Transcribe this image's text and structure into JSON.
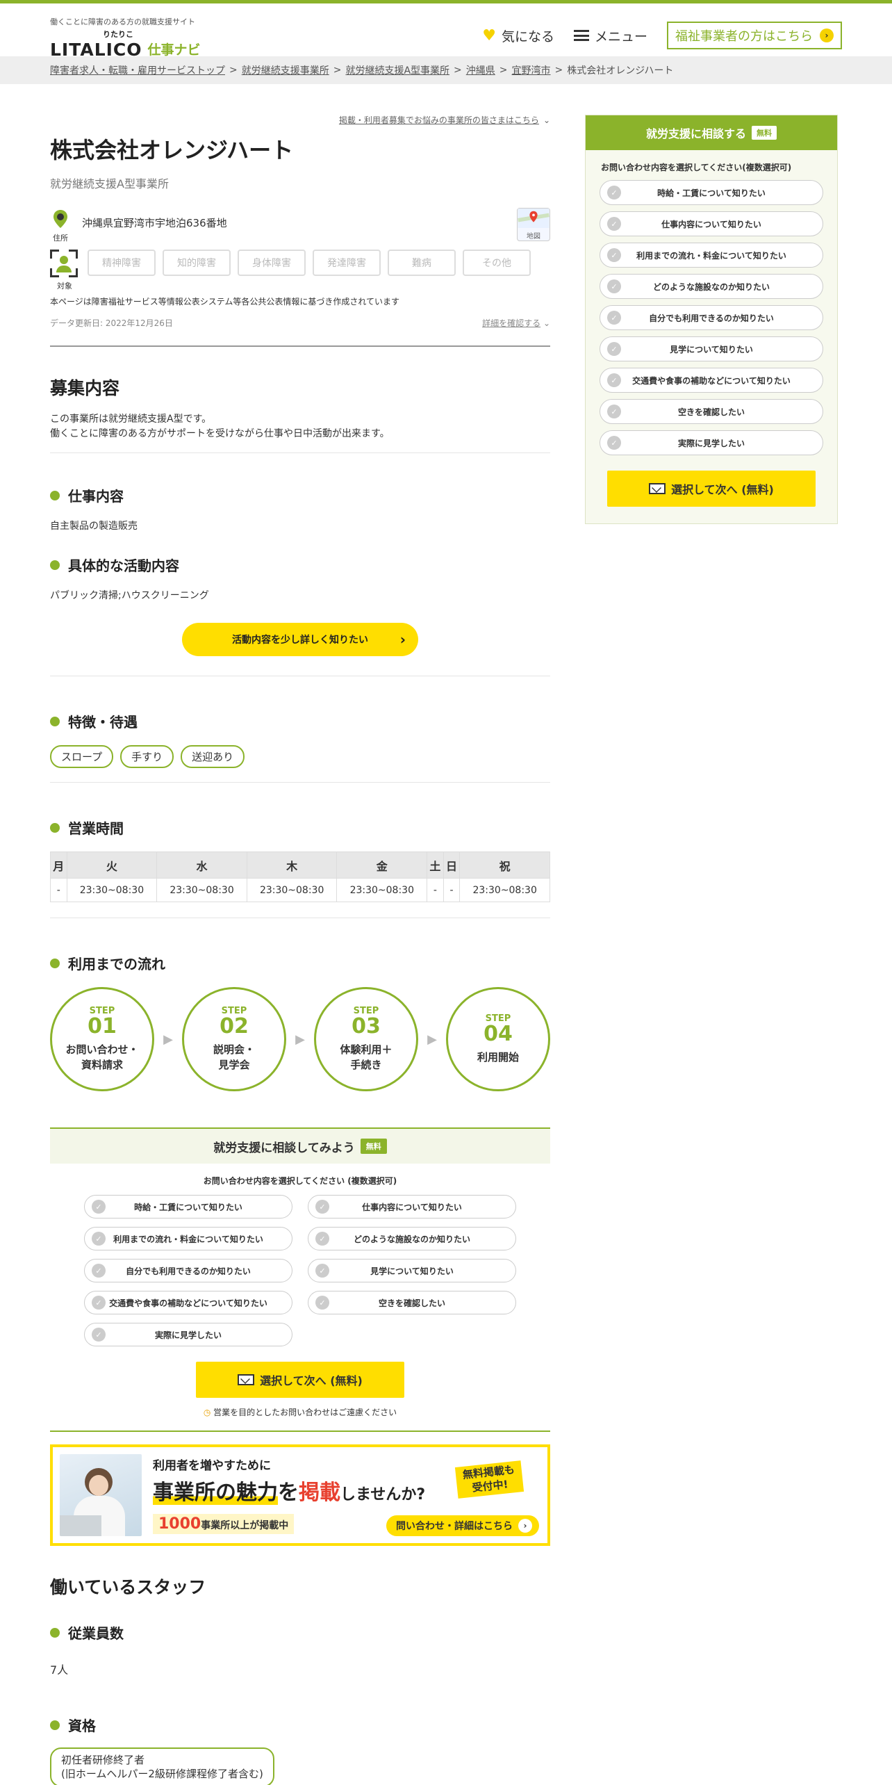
{
  "header": {
    "tagline": "働くことに障害のある方の就職支援サイト",
    "logo_ruby": "りたりこ",
    "logo_main": "LITALICO",
    "logo_sub": "仕事ナビ",
    "favorite_label": "気になる",
    "menu_label": "メニュー",
    "business_link": "福祉事業者の方はこちら"
  },
  "breadcrumb": {
    "items": [
      "障害者求人・転職・雇用サービストップ",
      "就労継続支援事業所",
      "就労継続支援A型事業所",
      "沖縄県",
      "宜野湾市"
    ],
    "current": "株式会社オレンジハート"
  },
  "facility": {
    "recruit_link": "掲載・利用者募集でお悩みの事業所の皆さまはこちら",
    "name": "株式会社オレンジハート",
    "type": "就労継続支援A型事業所",
    "address_label": "住所",
    "address": "沖縄県宜野湾市宇地泊636番地",
    "map_label": "地図",
    "target_label": "対象",
    "targets": [
      "精神障害",
      "知的障害",
      "身体障害",
      "発達障害",
      "難病",
      "その他"
    ],
    "note": "本ページは障害福祉サービス等情報公表システム等各公共公表情報に基づき作成されています",
    "updated": "データ更新日: 2022年12月26日",
    "detail_link": "詳細を確認する"
  },
  "recruit": {
    "title": "募集内容",
    "desc1": "この事業所は就労継続支援A型です。",
    "desc2": "働くことに障害のある方がサポートを受けながら仕事や日中活動が出来ます。",
    "work_title": "仕事内容",
    "work_text": "自主製品の製造販売",
    "activity_title": "具体的な活動内容",
    "activity_text": "パブリック清掃;ハウスクリーニング",
    "more_button": "活動内容を少し詳しく知りたい"
  },
  "features": {
    "title": "特徴・待遇",
    "items": [
      "スロープ",
      "手すり",
      "送迎あり"
    ]
  },
  "hours": {
    "title": "営業時間",
    "days": [
      "月",
      "火",
      "水",
      "木",
      "金",
      "土",
      "日",
      "祝"
    ],
    "times": [
      "-",
      "23:30~08:30",
      "23:30~08:30",
      "23:30~08:30",
      "23:30~08:30",
      "-",
      "-",
      "23:30~08:30"
    ]
  },
  "flow": {
    "title": "利用までの流れ",
    "step_label": "STEP",
    "steps": [
      {
        "num": "01",
        "line1": "お問い合わせ・",
        "line2": "資料請求"
      },
      {
        "num": "02",
        "line1": "説明会・",
        "line2": "見学会"
      },
      {
        "num": "03",
        "line1": "体験利用＋",
        "line2": "手続き"
      },
      {
        "num": "04",
        "line1": "利用開始",
        "line2": ""
      }
    ]
  },
  "consult": {
    "title": "就労支援に相談してみよう",
    "free": "無料",
    "question": "お問い合わせ内容を選択してください (複数選択可)",
    "options": [
      "時給・工賃について知りたい",
      "仕事内容について知りたい",
      "利用までの流れ・料金について知りたい",
      "どのような施設なのか知りたい",
      "自分でも利用できるのか知りたい",
      "見学について知りたい",
      "交通費や食事の補助などについて知りたい",
      "空きを確認したい",
      "実際に見学したい"
    ],
    "next_button": "選択して次へ (無料)",
    "warning": "営業を目的としたお問い合わせはご遠慮ください"
  },
  "banner": {
    "line1": "利用者を増やすために",
    "line2a": "事業所の",
    "line2b": "魅力",
    "line2c": "を",
    "line2d": "掲載",
    "line2e": "しませんか?",
    "stamp1": "無料掲載も",
    "stamp2": "受付中!",
    "count_num": "1000",
    "count_text": "事業所以上が掲載中",
    "cta": "問い合わせ・詳細はこちら"
  },
  "staff": {
    "title": "働いているスタッフ",
    "count_title": "従業員数",
    "count": "7人",
    "qual_title": "資格",
    "qual1": "初任者研修終了者",
    "qual2": "(旧ホームヘルパー2級研修課程修了者含む)"
  },
  "sidebar": {
    "title": "就労支援に相談する",
    "free": "無料",
    "question": "お問い合わせ内容を選択してください(複数選択可)",
    "options": [
      "時給・工賃について知りたい",
      "仕事内容について知りたい",
      "利用までの流れ・料金について知りたい",
      "どのような施設なのか知りたい",
      "自分でも利用できるのか知りたい",
      "見学について知りたい",
      "交通費や食事の補助などについて知りたい",
      "空きを確認したい",
      "実際に見学したい"
    ],
    "next_button": "選択して次へ (無料)"
  },
  "colors": {
    "accent": "#8bb32b",
    "cta": "#ffde00",
    "highlight": "#e8402f"
  }
}
